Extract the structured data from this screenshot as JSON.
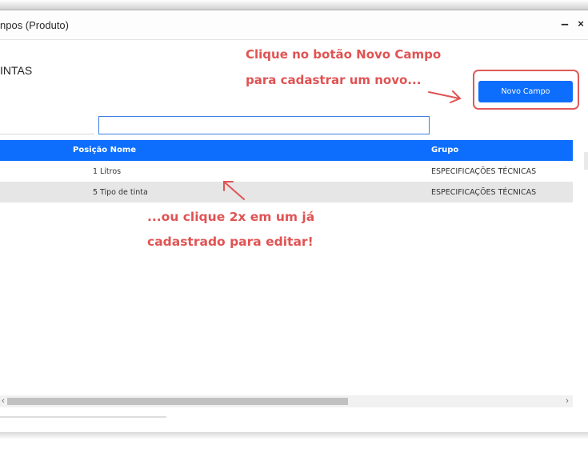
{
  "window": {
    "title": "npos (Produto)",
    "minimize_label": "–",
    "close_label": "×"
  },
  "product": {
    "name": "INTAS"
  },
  "annotations": {
    "button_hint_line1": "Clique no botão Novo Campo",
    "button_hint_line2": "para cadastrar um novo...",
    "row_hint_line1": "...ou clique 2x em um já",
    "row_hint_line2": "cadastrado para editar!"
  },
  "toolbar": {
    "novo_campo_label": "Novo Campo"
  },
  "search": {
    "value": ""
  },
  "grid": {
    "headers": {
      "posicao_nome": "Posição Nome",
      "grupo": "Grupo"
    },
    "rows": [
      {
        "posicao": "1",
        "nome": "Litros",
        "grupo": "ESPECIFICAÇÕES TÉCNICAS"
      },
      {
        "posicao": "5",
        "nome": "Tipo de tinta",
        "grupo": "ESPECIFICAÇÕES TÉCNICAS"
      }
    ]
  },
  "scrollbar": {
    "left_arrow": "‹",
    "right_arrow": "›"
  },
  "colors": {
    "accent": "#0d6efd",
    "annotation": "#e05353",
    "row_selected": "#e6e6e6"
  }
}
